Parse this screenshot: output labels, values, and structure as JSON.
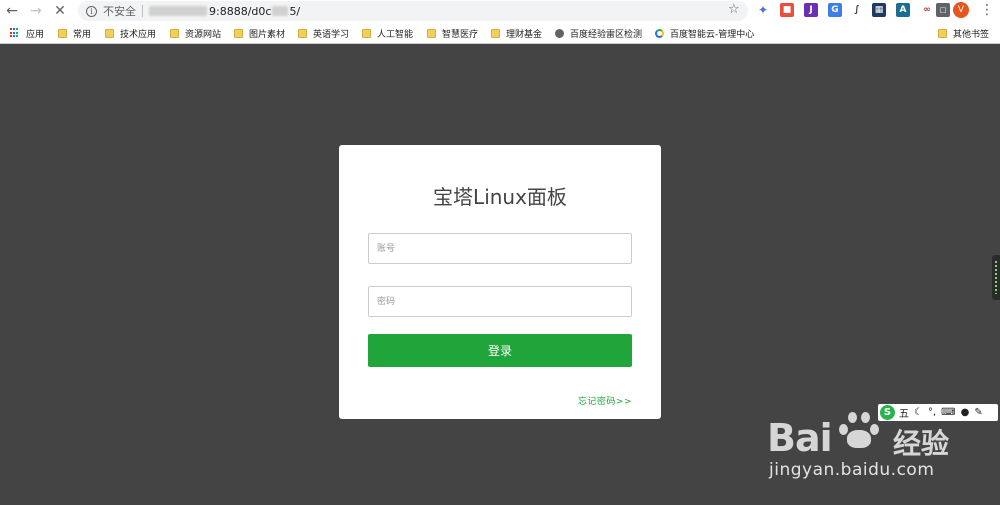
{
  "browser": {
    "insecure_label": "不安全",
    "url_visible_part": "9:8888/d0c",
    "url_tail": "5/"
  },
  "bookmarks": {
    "apps": "应用",
    "items": [
      "常用",
      "技术应用",
      "资源网站",
      "图片素材",
      "英语学习",
      "人工智能",
      "智慧医疗",
      "理财基金",
      "百度经验雷区检测",
      "百度智能云-管理中心"
    ],
    "other": "其他书签"
  },
  "login": {
    "title": "宝塔Linux面板",
    "username_placeholder": "账号",
    "password_placeholder": "密码",
    "submit_label": "登录",
    "forgot_label": "忘记密码>>"
  },
  "ime": {
    "logo": "S",
    "mode": "五",
    "items": [
      "☾",
      "°,",
      "⌨",
      "●",
      "✎"
    ]
  },
  "watermark": {
    "brand": "Bai",
    "brand_cn": "经验",
    "site": "jingyan.baidu.com"
  },
  "avatar_letter": "V"
}
